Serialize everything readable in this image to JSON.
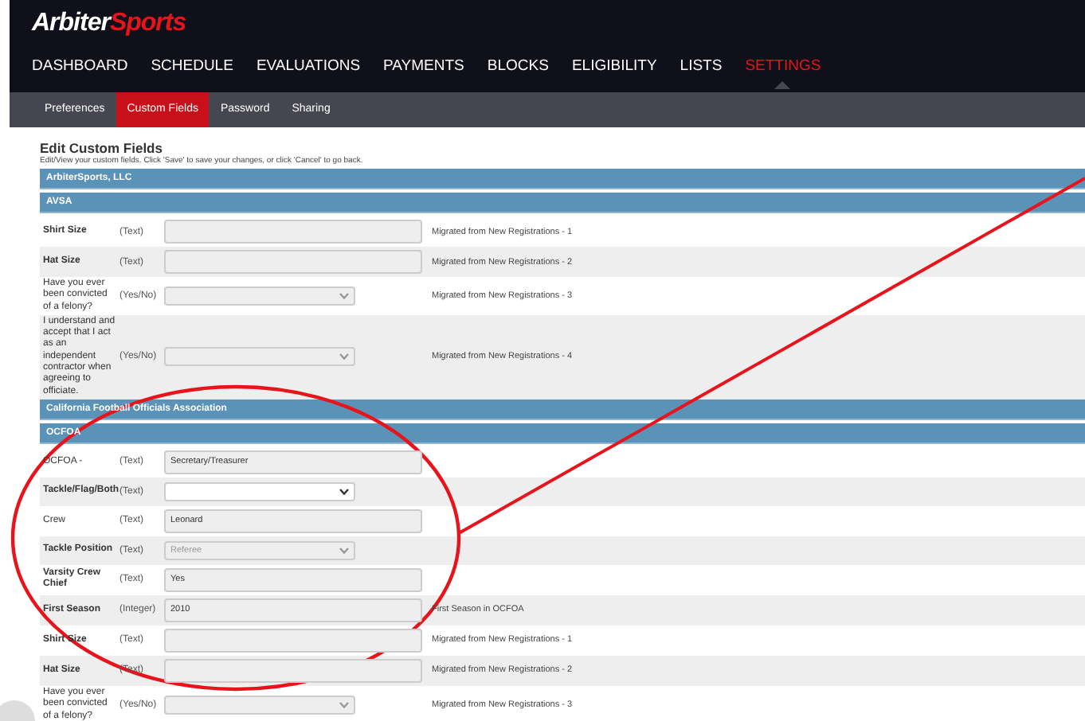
{
  "logo": {
    "part1": "Arbiter",
    "part2": "Sports"
  },
  "nav": [
    {
      "label": "DASHBOARD",
      "selected": false
    },
    {
      "label": "SCHEDULE",
      "selected": false
    },
    {
      "label": "EVALUATIONS",
      "selected": false
    },
    {
      "label": "PAYMENTS",
      "selected": false
    },
    {
      "label": "BLOCKS",
      "selected": false
    },
    {
      "label": "ELIGIBILITY",
      "selected": false
    },
    {
      "label": "LISTS",
      "selected": false
    },
    {
      "label": "SETTINGS",
      "selected": true
    }
  ],
  "subnav": [
    {
      "label": "Preferences",
      "selected": false
    },
    {
      "label": "Custom Fields",
      "selected": true
    },
    {
      "label": "Password",
      "selected": false
    },
    {
      "label": "Sharing",
      "selected": false
    }
  ],
  "page": {
    "title": "Edit Custom Fields",
    "subtitle": "Edit/View your custom fields. Click 'Save' to save your changes, or click 'Cancel' to go back."
  },
  "sections": [
    {
      "kind": "org",
      "title": "ArbiterSports, LLC"
    },
    {
      "kind": "group",
      "title": "AVSA"
    },
    {
      "kind": "text",
      "label": "Shirt Size",
      "required": true,
      "type": "(Text)",
      "note": "Migrated from New Registrations - 1"
    },
    {
      "kind": "text",
      "label": "Hat Size",
      "required": true,
      "type": "(Text)",
      "note": "Migrated from New Registrations - 2"
    },
    {
      "kind": "select",
      "label": "Have you ever been convicted of a felony?",
      "required": false,
      "type": "(Yes/No)",
      "disabled": true,
      "note": "Migrated from New Registrations - 3"
    },
    {
      "kind": "select",
      "label": "I understand and accept that I act as an independent contractor when agreeing to officiate.",
      "required": false,
      "type": "(Yes/No)",
      "disabled": true,
      "note": "Migrated from New Registrations - 4"
    },
    {
      "kind": "org",
      "title": "California Football Officials Association"
    },
    {
      "kind": "group",
      "title": "OCFOA"
    },
    {
      "kind": "text",
      "label": "OCFOA -",
      "required": false,
      "type": "(Text)",
      "value": "Secretary/Treasurer"
    },
    {
      "kind": "select",
      "label": "Tackle/Flag/Both",
      "required": true,
      "type": "(Text)",
      "disabled": false
    },
    {
      "kind": "text",
      "label": "Crew",
      "required": false,
      "type": "(Text)",
      "value": "Leonard"
    },
    {
      "kind": "select",
      "label": "Tackle Position",
      "required": true,
      "type": "(Text)",
      "disabled": true,
      "value": "Referee"
    },
    {
      "kind": "text",
      "label": "Varsity Crew Chief",
      "required": true,
      "type": "(Text)",
      "value": "Yes"
    },
    {
      "kind": "text",
      "label": "First Season",
      "required": true,
      "type": "(Integer)",
      "value": "2010",
      "note": "First Season in OCFOA"
    },
    {
      "kind": "text",
      "label": "Shirt Size",
      "required": true,
      "type": "(Text)",
      "note": "Migrated from New Registrations - 1"
    },
    {
      "kind": "text",
      "label": "Hat Size",
      "required": true,
      "type": "(Text)",
      "note": "Migrated from New Registrations - 2"
    },
    {
      "kind": "select",
      "label": "Have you ever been convicted of a felony?",
      "required": false,
      "type": "(Yes/No)",
      "disabled": true,
      "note": "Migrated from New Registrations - 3"
    }
  ]
}
